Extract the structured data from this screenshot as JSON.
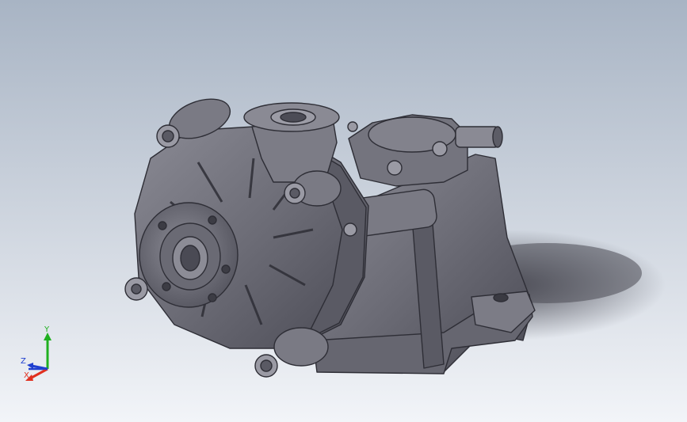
{
  "viewport": {
    "background_top": "#a8b4c4",
    "background_bottom": "#f2f4f8",
    "model_color": "#6e6e78",
    "model_dark": "#3c3c44",
    "model_light": "#9a9aa4",
    "shadow_color": "#50505a"
  },
  "triad": {
    "x_label": "X",
    "y_label": "Y",
    "z_label": "Z",
    "x_color": "#e03020",
    "y_color": "#20b020",
    "z_color": "#2040d0"
  }
}
